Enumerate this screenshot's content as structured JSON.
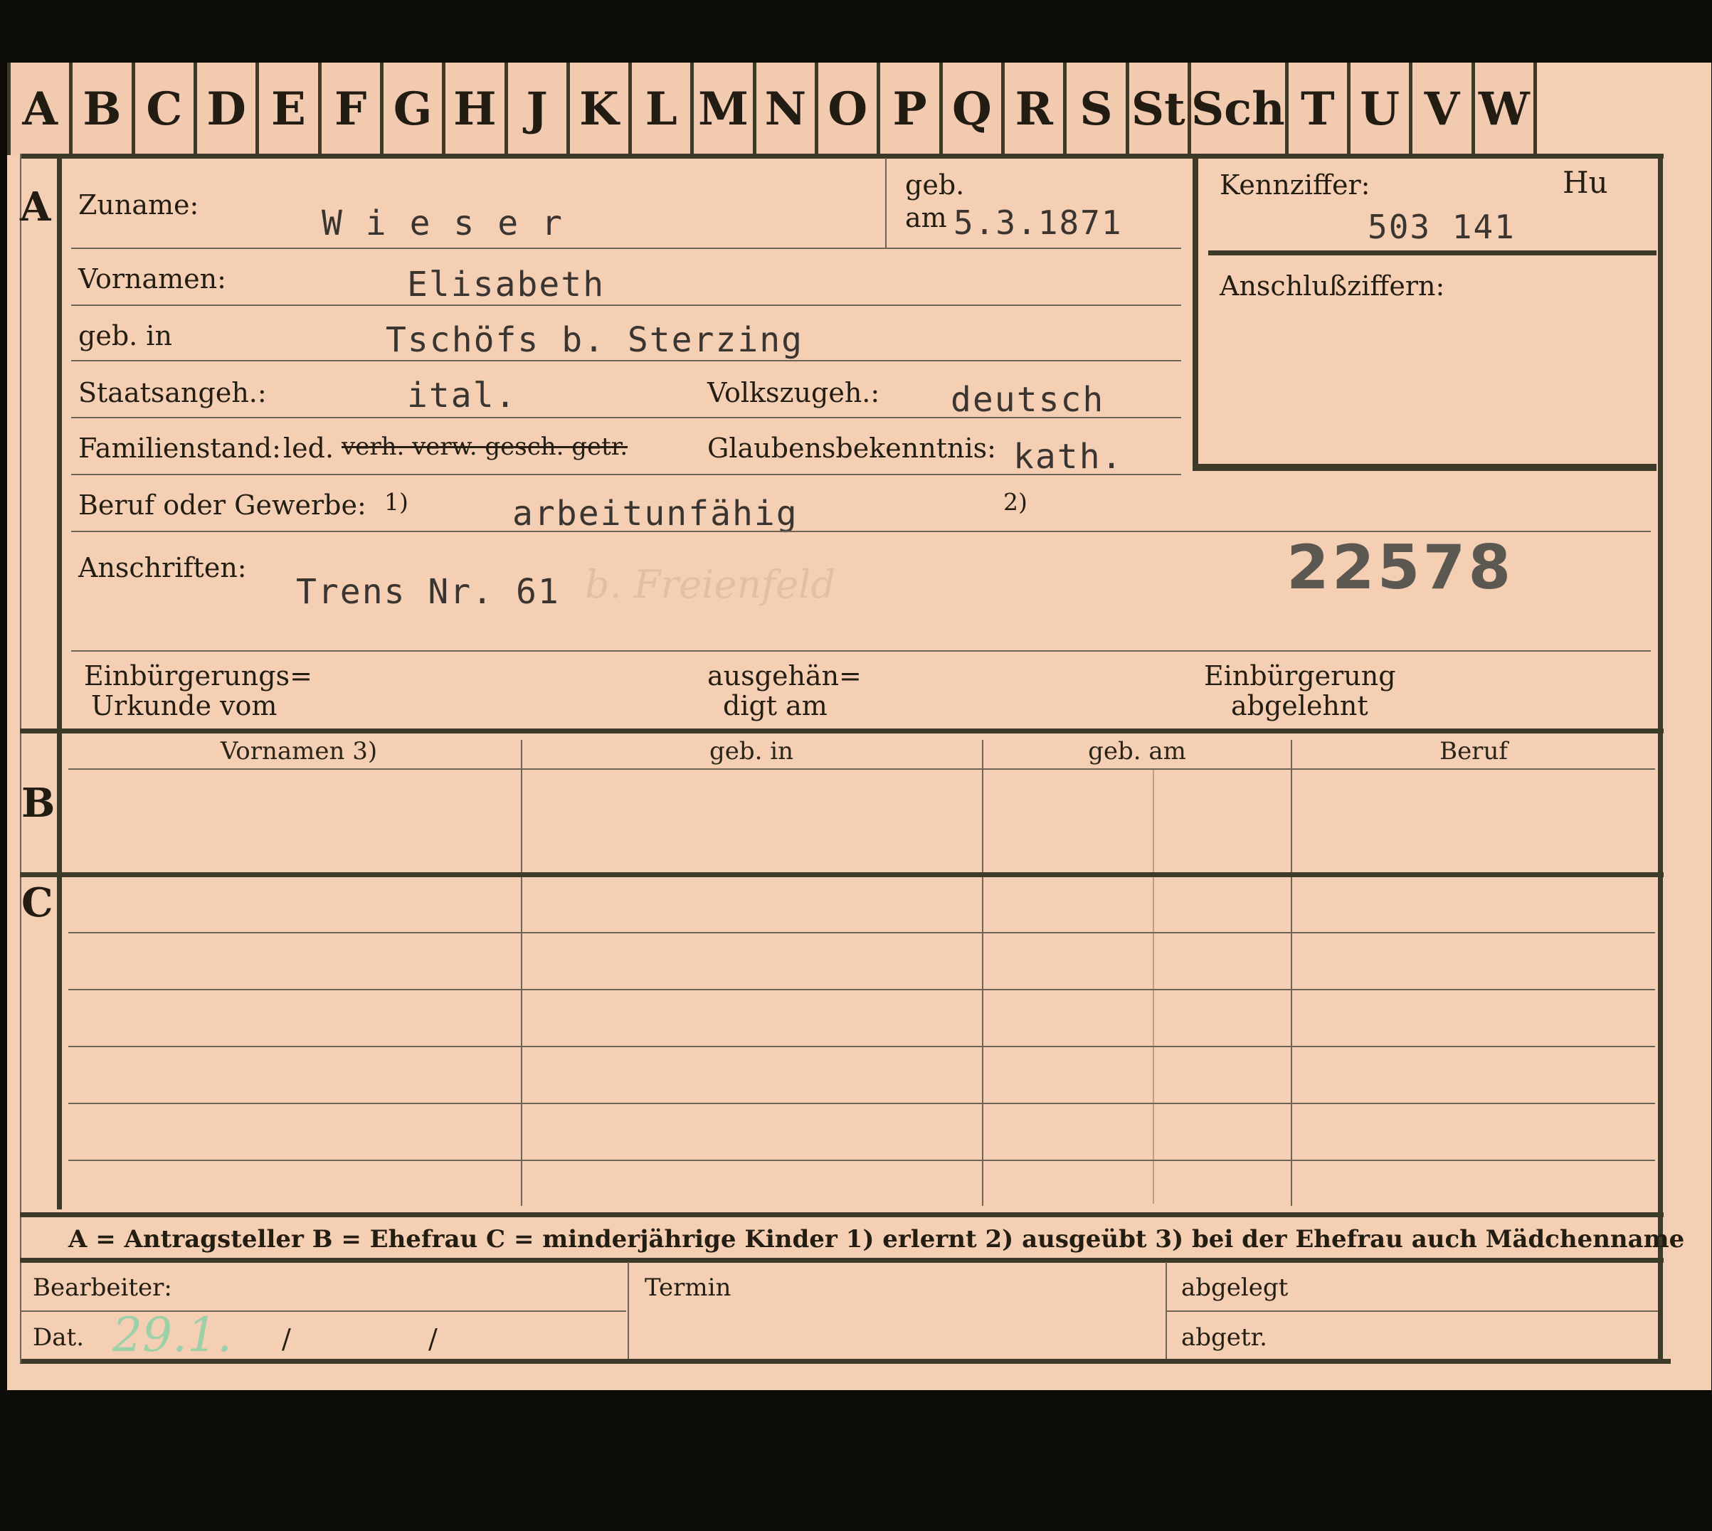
{
  "tabs": [
    "A",
    "B",
    "C",
    "D",
    "E",
    "F",
    "G",
    "H",
    "J",
    "K",
    "L",
    "M",
    "N",
    "O",
    "P",
    "Q",
    "R",
    "S",
    "St",
    "Sch",
    "T",
    "U",
    "V",
    "W"
  ],
  "sections": {
    "a": "A",
    "b": "B",
    "c": "C"
  },
  "person": {
    "surname_label": "Zuname:",
    "surname_value": "W i e s e r",
    "born_label_1": "geb.",
    "born_label_2": "am",
    "born_value": "5.3.1871",
    "firstnames_label": "Vornamen:",
    "firstnames_value": "Elisabeth",
    "birthplace_label": "geb. in",
    "birthplace_value": "Tschöfs b. Sterzing",
    "citizenship_label": "Staatsangeh.:",
    "citizenship_value": "ital.",
    "ethnicity_label": "Volkszugeh.:",
    "ethnicity_value": "deutsch",
    "marital_label": "Familienstand:",
    "marital_single": "led.",
    "marital_struck": "verh. verw. gesch. getr.",
    "religion_label": "Glaubensbekenntnis:",
    "religion_value": "kath.",
    "occupation_label": "Beruf oder Gewerbe:",
    "footnote_1": "1)",
    "occupation_value": "arbeitunfähig",
    "footnote_2": "2)",
    "address_label": "Anschriften:",
    "address_value": "Trens Nr. 61",
    "address_handwritten": "b. Freienfeld",
    "stamp_number": "22578"
  },
  "ident": {
    "kennziffer_label": "Kennziffer:",
    "kennziffer_code": "Hu",
    "kennziffer_value": "503 141",
    "anschluss_label": "Anschlußziffern:"
  },
  "naturalization": {
    "cert_label_1": "Einbürgerungs=",
    "cert_label_2": "Urkunde vom",
    "handed_label_1": "ausgehän=",
    "handed_label_2": "digt am",
    "refused_label_1": "Einbürgerung",
    "refused_label_2": "abgelehnt"
  },
  "table_headers": [
    "Vornamen 3)",
    "geb. in",
    "geb. am",
    "Beruf"
  ],
  "legend": "A = Antragsteller   B = Ehefrau   C = minderjährige Kinder   1) erlernt   2) ausgeübt   3) bei der Ehefrau auch Mädchenname",
  "footer": {
    "bearbeiter_label": "Bearbeiter:",
    "dat_label": "Dat.",
    "dat_handwritten": "29.1.",
    "slash_1": "/",
    "slash_2": "/",
    "termin_label": "Termin",
    "abgelegt_label": "abgelegt",
    "abgetr_label": "abgetr."
  },
  "colors": {
    "card": "#f4cfb4",
    "ink": "#241d12",
    "typed": "#3a3530",
    "stamp": "#5a5850",
    "pencil_green": "#9bd0a8"
  }
}
